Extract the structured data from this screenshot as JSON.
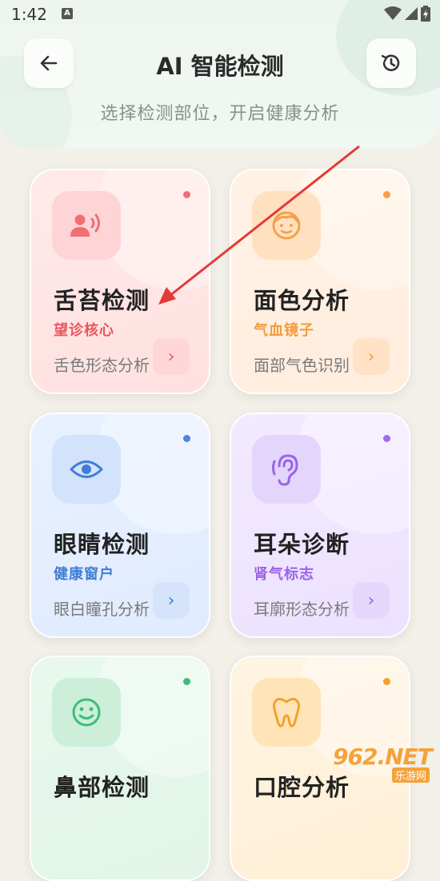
{
  "status_bar": {
    "time": "1:42",
    "notification_icon": "A"
  },
  "header": {
    "title": "AI 智能检测",
    "subtitle": "选择检测部位，开启健康分析",
    "back_icon": "arrow-left-icon",
    "history_icon": "history-icon"
  },
  "cards": [
    {
      "name": "舌苔检测",
      "tag": "望诊核心",
      "desc": "舌色形态分析",
      "icon": "tongue-speaking-icon",
      "color": "#e8575d"
    },
    {
      "name": "面色分析",
      "tag": "气血镜子",
      "desc": "面部气色识别",
      "icon": "face-icon",
      "color": "#f39a3d"
    },
    {
      "name": "眼睛检测",
      "tag": "健康窗户",
      "desc": "眼白瞳孔分析",
      "icon": "eye-icon",
      "color": "#3f7ed6"
    },
    {
      "name": "耳朵诊断",
      "tag": "肾气标志",
      "desc": "耳廓形态分析",
      "icon": "ear-icon",
      "color": "#9a63e8"
    },
    {
      "name": "鼻部检测",
      "icon": "smile-icon",
      "color": "#3dbd78"
    },
    {
      "name": "口腔分析",
      "icon": "tooth-icon",
      "color": "#f2a12e"
    }
  ],
  "watermark": {
    "brand": "962.NET",
    "sub": "乐游网"
  }
}
